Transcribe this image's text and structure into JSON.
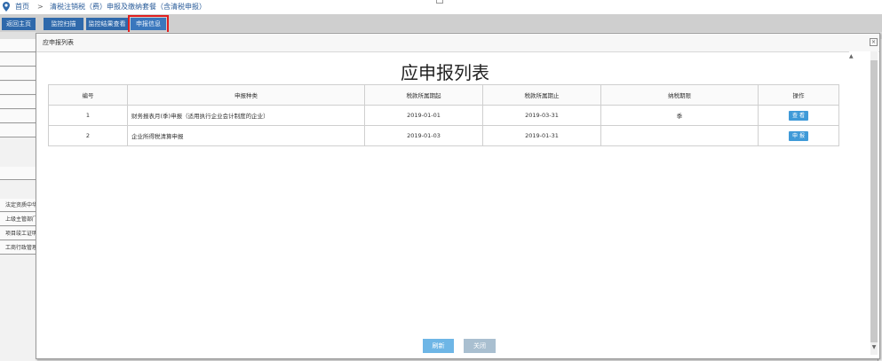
{
  "breadcrumb": {
    "home": "首页",
    "separator": ">",
    "current": "清税注销税（费）申报及缴纳套餐（含清税申报）"
  },
  "tabs": [
    {
      "label": "返回主页"
    },
    {
      "label": "监控扫描"
    },
    {
      "label": "监控结果查看"
    },
    {
      "label": "申报信息"
    }
  ],
  "background": {
    "rows": [
      "法定资质中华",
      "上级主管部门",
      "项目竣工证明",
      "工商行政管理"
    ]
  },
  "dialog": {
    "title": "应申报列表",
    "close_glyph": "×",
    "heading": "应申报列表",
    "columns": [
      "编号",
      "申报种类",
      "税款所属期起",
      "税款所属期止",
      "纳税期限",
      "操作"
    ],
    "rows": [
      {
        "no": "1",
        "type": "财务报表月(季)申报（适用执行企业会计制度的企业）",
        "start": "2019-01-01",
        "end": "2019-03-31",
        "period": "季",
        "action": "查 看"
      },
      {
        "no": "2",
        "type": "企业所得税清算申报",
        "start": "2019-01-03",
        "end": "2019-01-31",
        "period": "",
        "action": "申 报"
      }
    ],
    "buttons": {
      "refresh": "刷新",
      "close": "关闭"
    }
  },
  "colors": {
    "tab": "#2f69ab",
    "action_button": "#3f9ad8",
    "highlight": "#e02020"
  }
}
